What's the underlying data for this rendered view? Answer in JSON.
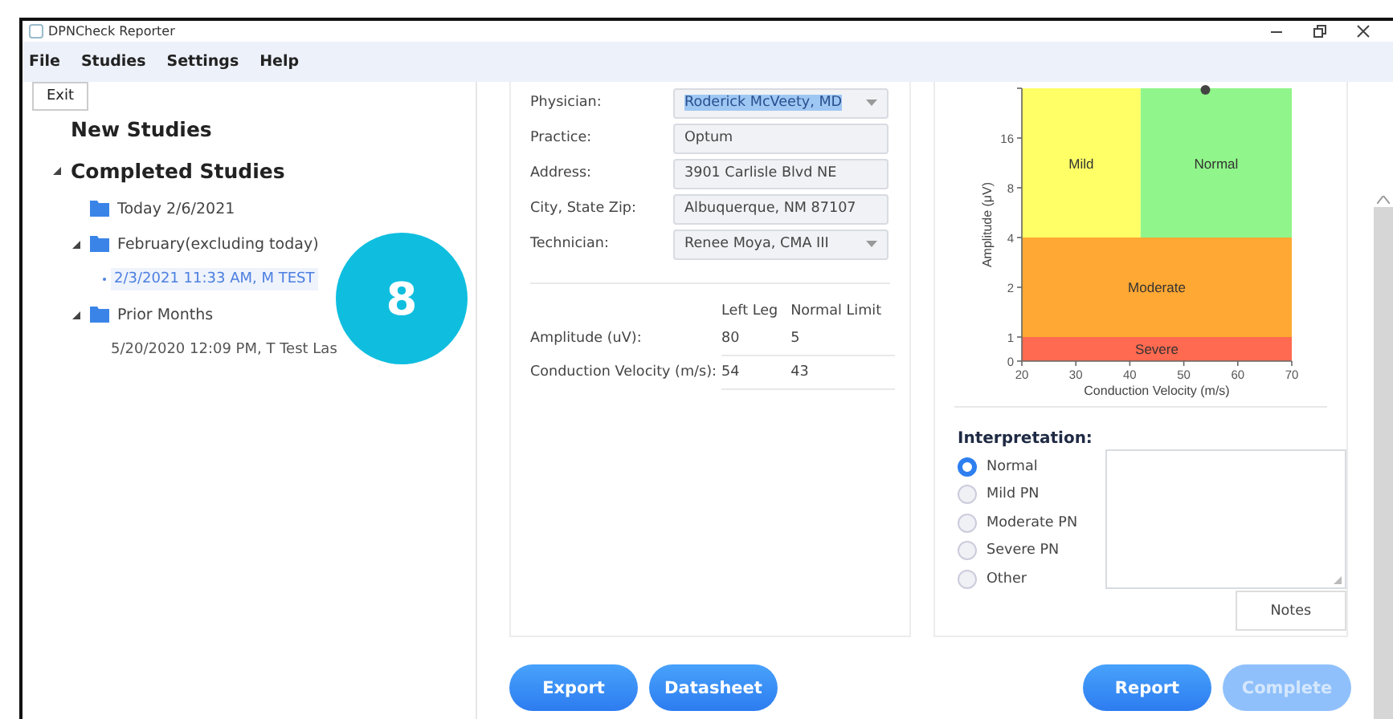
{
  "window": {
    "title": "DPNCheck Reporter"
  },
  "menu": [
    "File",
    "Studies",
    "Settings",
    "Help"
  ],
  "file_menu": [
    "Exit"
  ],
  "tree": [
    {
      "label": "New Studies",
      "kind": "heading"
    },
    {
      "label": "Completed Studies",
      "kind": "heading",
      "expanded": true,
      "children": [
        {
          "label": "Today 2/6/2021",
          "kind": "folder"
        },
        {
          "label": "February(excluding today)",
          "kind": "folder",
          "expanded": true,
          "children": [
            {
              "label": "2/3/2021 11:33 AM, M TEST",
              "kind": "study",
              "selected": true
            }
          ]
        },
        {
          "label": "Prior Months",
          "kind": "folder",
          "expanded": true,
          "children": [
            {
              "label": "5/20/2020 12:09 PM, T Test Las",
              "kind": "study",
              "selected": false
            }
          ]
        }
      ]
    }
  ],
  "callout": {
    "label": "8"
  },
  "patient_form": {
    "fields": [
      {
        "label": "Physician:",
        "value": "Roderick McVeety, MD",
        "kind": "dropdown",
        "highlighted": true
      },
      {
        "label": "Practice:",
        "value": "Optum",
        "kind": "text",
        "highlighted": false
      },
      {
        "label": "Address:",
        "value": "3901 Carlisle Blvd NE",
        "kind": "text",
        "highlighted": false
      },
      {
        "label": "City, State Zip:",
        "value": "Albuquerque, NM 87107",
        "kind": "text",
        "highlighted": false
      },
      {
        "label": "Technician:",
        "value": "Renee Moya, CMA III",
        "kind": "dropdown",
        "highlighted": false
      }
    ]
  },
  "results": {
    "columns": [
      "Left Leg",
      "Normal Limit"
    ],
    "rows": [
      {
        "label": "Amplitude (uV):",
        "values": [
          "80",
          "5"
        ]
      },
      {
        "label": "Conduction Velocity (m/s):",
        "values": [
          "54",
          "43"
        ]
      }
    ]
  },
  "chart": {
    "ylabel": "Amplitude (μV)",
    "xlabel": "Conduction Velocity (m/s)",
    "y_tick_labels": [
      "16",
      "8",
      "4",
      "2",
      "1",
      "0"
    ],
    "x_tick_labels": [
      "20",
      "30",
      "40",
      "50",
      "60",
      "70"
    ],
    "zones": [
      {
        "label": "Mild",
        "color": "#ffff66"
      },
      {
        "label": "Normal",
        "color": "#90f58a"
      },
      {
        "label": "Moderate",
        "color": "#ffa833"
      },
      {
        "label": "Severe",
        "color": "#ff6a50"
      }
    ]
  },
  "interpretation": {
    "title": "Interpretation:",
    "options": [
      {
        "label": "Normal",
        "selected": true
      },
      {
        "label": "Mild PN",
        "selected": false
      },
      {
        "label": "Moderate PN",
        "selected": false
      },
      {
        "label": "Severe PN",
        "selected": false
      },
      {
        "label": "Other",
        "selected": false
      }
    ],
    "notes_button": "Notes"
  },
  "left_buttons": [
    {
      "label": "Export",
      "disabled": false
    },
    {
      "label": "Datasheet",
      "disabled": false
    }
  ],
  "right_buttons": [
    {
      "label": "Report",
      "disabled": false
    },
    {
      "label": "Complete",
      "disabled": true
    }
  ]
}
